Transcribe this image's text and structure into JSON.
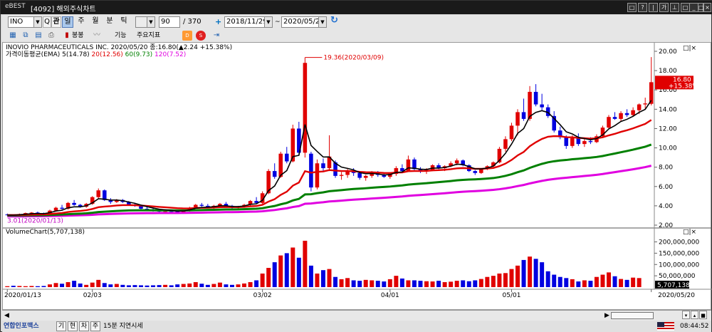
{
  "window": {
    "logo": "eBEST",
    "title": "[4092] 해외주식차트",
    "controls": [
      "□",
      "?",
      "|",
      "가",
      "⊥",
      "□",
      "_",
      "□",
      "×"
    ]
  },
  "toolbar": {
    "symbol": "INO",
    "search_label": "Q",
    "tabs": [
      "관",
      "일",
      "주",
      "월",
      "분",
      "틱"
    ],
    "active_tab": "일",
    "count": "90",
    "total": "/ 370",
    "date_from": "2018/11/29",
    "date_sep": "~",
    "date_to": "2020/05/20",
    "add_label": "+",
    "refresh_label": "↻"
  },
  "toolbar2": {
    "labels": [
      "봉봉",
      "기능",
      "주요지표"
    ],
    "icons": [
      "grid-icon",
      "copy-icon",
      "save-icon",
      "print-icon",
      "candle-icon",
      "line-icon",
      "data-icon",
      "wide-icon"
    ]
  },
  "chart_data": [
    {
      "type": "candlestick",
      "title": "INOVIO PHARMACEUTICALS INC.",
      "header_price": "2020/05/20 종:16.80(▲2.24 +15.38%)",
      "legend": [
        {
          "name": "가격이동평균(EMA)",
          "value": "5(14.78)",
          "color": "#000000"
        },
        {
          "name": "20",
          "value": "20(12.56)",
          "color": "#e00000"
        },
        {
          "name": "60",
          "value": "60(9.73)",
          "color": "#008000"
        },
        {
          "name": "120",
          "value": "120(7.52)",
          "color": "#e000e0"
        }
      ],
      "ylim": [
        2,
        20
      ],
      "yticks": [
        "20.00",
        "18.00",
        "16.00",
        "14.00",
        "12.00",
        "10.00",
        "8.00",
        "6.00",
        "4.00",
        "2.00"
      ],
      "annotations": {
        "high": "19.36(2020/03/09)",
        "low": "3.01(2020/01/13)"
      },
      "current_price_box": [
        "16.80",
        "+15.38%"
      ],
      "colors": {
        "up": "#e00000",
        "down": "#0000e0"
      },
      "candles": [
        [
          3.1,
          3.2,
          3.0,
          3.05
        ],
        [
          3.05,
          3.1,
          2.95,
          3.0
        ],
        [
          3.0,
          3.2,
          2.98,
          3.15
        ],
        [
          3.15,
          3.3,
          3.1,
          3.25
        ],
        [
          3.25,
          3.35,
          3.2,
          3.3
        ],
        [
          3.3,
          3.4,
          3.2,
          3.25
        ],
        [
          3.25,
          3.3,
          3.1,
          3.15
        ],
        [
          3.15,
          3.6,
          3.1,
          3.5
        ],
        [
          3.5,
          3.9,
          3.4,
          3.8
        ],
        [
          3.8,
          4.1,
          3.6,
          3.7
        ],
        [
          3.7,
          4.4,
          3.6,
          4.3
        ],
        [
          4.3,
          4.6,
          4.0,
          4.1
        ],
        [
          4.1,
          4.2,
          3.8,
          3.9
        ],
        [
          3.9,
          4.3,
          3.8,
          4.2
        ],
        [
          4.2,
          5.0,
          4.1,
          4.9
        ],
        [
          4.9,
          5.8,
          4.7,
          5.6
        ],
        [
          5.6,
          5.7,
          4.5,
          4.6
        ],
        [
          4.6,
          4.8,
          4.2,
          4.4
        ],
        [
          4.4,
          4.7,
          4.3,
          4.6
        ],
        [
          4.6,
          4.7,
          4.3,
          4.4
        ],
        [
          4.4,
          4.5,
          4.0,
          4.1
        ],
        [
          4.1,
          4.3,
          3.9,
          4.0
        ],
        [
          4.0,
          4.1,
          3.6,
          3.7
        ],
        [
          3.7,
          3.9,
          3.5,
          3.6
        ],
        [
          3.6,
          3.8,
          3.4,
          3.5
        ],
        [
          3.5,
          3.7,
          3.3,
          3.4
        ],
        [
          3.4,
          3.6,
          3.2,
          3.45
        ],
        [
          3.45,
          3.6,
          3.3,
          3.4
        ],
        [
          3.4,
          3.5,
          3.2,
          3.3
        ],
        [
          3.3,
          3.6,
          3.25,
          3.5
        ],
        [
          3.5,
          3.9,
          3.4,
          3.8
        ],
        [
          3.8,
          4.2,
          3.7,
          4.1
        ],
        [
          4.1,
          4.3,
          3.9,
          4.0
        ],
        [
          4.0,
          4.2,
          3.8,
          3.9
        ],
        [
          3.9,
          4.1,
          3.7,
          4.0
        ],
        [
          4.0,
          4.3,
          3.9,
          4.2
        ],
        [
          4.2,
          4.4,
          3.9,
          4.0
        ],
        [
          4.0,
          4.1,
          3.7,
          3.8
        ],
        [
          3.8,
          4.0,
          3.7,
          3.9
        ],
        [
          3.9,
          4.2,
          3.8,
          4.1
        ],
        [
          4.1,
          4.6,
          4.0,
          4.5
        ],
        [
          4.5,
          4.9,
          4.2,
          4.3
        ],
        [
          4.3,
          5.5,
          4.2,
          5.3
        ],
        [
          5.3,
          7.8,
          5.2,
          7.6
        ],
        [
          7.6,
          8.4,
          6.8,
          7.0
        ],
        [
          7.0,
          9.6,
          6.9,
          9.4
        ],
        [
          9.4,
          10.1,
          8.4,
          8.6
        ],
        [
          8.6,
          12.4,
          8.5,
          12.0
        ],
        [
          12.0,
          12.7,
          9.2,
          9.5
        ],
        [
          9.5,
          19.36,
          9.0,
          18.8
        ],
        [
          9.4,
          9.6,
          5.5,
          5.9
        ],
        [
          5.9,
          8.8,
          5.7,
          8.4
        ],
        [
          8.4,
          8.9,
          7.5,
          7.9
        ],
        [
          7.9,
          11.3,
          7.6,
          9.1
        ],
        [
          8.5,
          8.7,
          6.9,
          7.1
        ],
        [
          7.1,
          7.5,
          6.7,
          7.2
        ],
        [
          7.2,
          7.8,
          6.9,
          7.6
        ],
        [
          7.6,
          7.9,
          7.1,
          7.4
        ],
        [
          7.4,
          7.6,
          6.7,
          6.9
        ],
        [
          6.9,
          7.2,
          6.6,
          7.1
        ],
        [
          7.1,
          7.6,
          6.9,
          7.4
        ],
        [
          7.4,
          7.6,
          7.0,
          7.2
        ],
        [
          7.2,
          7.4,
          6.9,
          7.0
        ],
        [
          7.0,
          7.4,
          6.8,
          7.3
        ],
        [
          7.3,
          8.1,
          7.1,
          7.9
        ],
        [
          7.9,
          8.3,
          7.4,
          7.6
        ],
        [
          7.6,
          9.2,
          7.5,
          8.8
        ],
        [
          8.8,
          9.0,
          7.7,
          7.8
        ],
        [
          7.8,
          8.0,
          7.4,
          7.6
        ],
        [
          7.6,
          7.9,
          7.3,
          7.7
        ],
        [
          7.7,
          8.3,
          7.6,
          8.2
        ],
        [
          8.2,
          8.4,
          7.8,
          7.9
        ],
        [
          7.9,
          8.2,
          7.6,
          8.1
        ],
        [
          8.1,
          8.6,
          8.0,
          8.4
        ],
        [
          8.4,
          8.9,
          8.2,
          8.7
        ],
        [
          8.7,
          8.8,
          8.1,
          8.2
        ],
        [
          8.2,
          8.3,
          7.5,
          7.6
        ],
        [
          7.6,
          7.7,
          7.2,
          7.4
        ],
        [
          7.4,
          7.9,
          7.3,
          7.8
        ],
        [
          7.8,
          8.2,
          7.7,
          8.1
        ],
        [
          8.1,
          8.6,
          8.0,
          8.5
        ],
        [
          8.5,
          10.1,
          8.4,
          9.9
        ],
        [
          9.9,
          11.2,
          9.6,
          10.9
        ],
        [
          10.9,
          12.6,
          10.7,
          12.3
        ],
        [
          12.3,
          14.0,
          11.3,
          13.7
        ],
        [
          13.7,
          15.1,
          12.8,
          13.0
        ],
        [
          13.0,
          16.4,
          12.8,
          15.8
        ],
        [
          15.8,
          16.6,
          14.3,
          14.5
        ],
        [
          14.5,
          15.6,
          13.9,
          14.2
        ],
        [
          14.2,
          14.5,
          13.1,
          13.3
        ],
        [
          13.3,
          13.8,
          11.6,
          11.8
        ],
        [
          11.8,
          12.2,
          10.9,
          11.1
        ],
        [
          11.1,
          11.3,
          9.9,
          10.2
        ],
        [
          10.2,
          11.3,
          10.0,
          11.0
        ],
        [
          11.0,
          11.5,
          10.2,
          10.4
        ],
        [
          10.4,
          10.9,
          10.1,
          10.7
        ],
        [
          10.7,
          11.1,
          10.4,
          10.6
        ],
        [
          10.6,
          11.4,
          10.5,
          11.2
        ],
        [
          11.2,
          12.3,
          11.1,
          12.1
        ],
        [
          12.1,
          13.4,
          11.9,
          13.2
        ],
        [
          13.2,
          13.7,
          12.9,
          13.0
        ],
        [
          13.0,
          13.8,
          12.7,
          13.6
        ],
        [
          13.6,
          14.0,
          13.2,
          13.4
        ],
        [
          13.4,
          14.2,
          13.2,
          13.9
        ],
        [
          13.9,
          14.6,
          13.5,
          14.5
        ],
        [
          14.5,
          15.2,
          14.0,
          14.6
        ],
        [
          14.56,
          19.4,
          14.4,
          16.8
        ]
      ]
    },
    {
      "type": "bar",
      "title": "VolumeChart(5,707,138)",
      "ylim": [
        0,
        230000000
      ],
      "yticks": [
        "200,000,000",
        "150,000,000",
        "100,000,000",
        "50,000,000"
      ],
      "current_value_box": "5,707,138",
      "volumes": [
        4,
        6,
        5,
        4,
        5,
        4,
        5,
        12,
        18,
        15,
        22,
        28,
        16,
        10,
        20,
        32,
        18,
        12,
        14,
        10,
        8,
        9,
        8,
        7,
        8,
        9,
        10,
        8,
        12,
        14,
        16,
        22,
        15,
        10,
        14,
        20,
        12,
        10,
        12,
        16,
        22,
        30,
        60,
        85,
        110,
        140,
        150,
        175,
        130,
        205,
        95,
        60,
        75,
        80,
        45,
        35,
        40,
        30,
        28,
        32,
        30,
        28,
        25,
        35,
        50,
        38,
        30,
        30,
        28,
        26,
        25,
        28,
        22,
        24,
        28,
        30,
        26,
        30,
        36,
        45,
        50,
        60,
        62,
        80,
        95,
        120,
        135,
        125,
        110,
        70,
        55,
        45,
        40,
        35,
        25,
        30,
        28,
        45,
        55,
        65,
        48,
        36,
        32,
        42,
        40
      ],
      "vol_colors": [
        0,
        1,
        0,
        0,
        0,
        1,
        1,
        0,
        0,
        1,
        0,
        1,
        1,
        0,
        0,
        0,
        1,
        1,
        0,
        1,
        1,
        1,
        1,
        1,
        1,
        1,
        0,
        1,
        1,
        0,
        0,
        0,
        1,
        1,
        0,
        0,
        1,
        1,
        0,
        0,
        0,
        1,
        0,
        0,
        1,
        0,
        1,
        0,
        1,
        0,
        1,
        0,
        1,
        0,
        1,
        0,
        0,
        1,
        1,
        0,
        0,
        1,
        1,
        0,
        0,
        1,
        0,
        1,
        1,
        0,
        0,
        1,
        0,
        0,
        0,
        1,
        1,
        1,
        0,
        0,
        0,
        0,
        0,
        0,
        0,
        1,
        0,
        1,
        1,
        1,
        1,
        1,
        1,
        0,
        1,
        0,
        1,
        0,
        0,
        0,
        1,
        0,
        1,
        0,
        0
      ]
    }
  ],
  "x_axis_labels": [
    "2020/01/13",
    "02/03",
    "03/02",
    "04/01",
    "05/01",
    "2020/05/20"
  ],
  "bottom": {
    "brand": "연합인포맥스",
    "buttons": [
      "기",
      "현",
      "차",
      "주"
    ],
    "delay": "15분 지연시세",
    "time": "08:44:52"
  }
}
